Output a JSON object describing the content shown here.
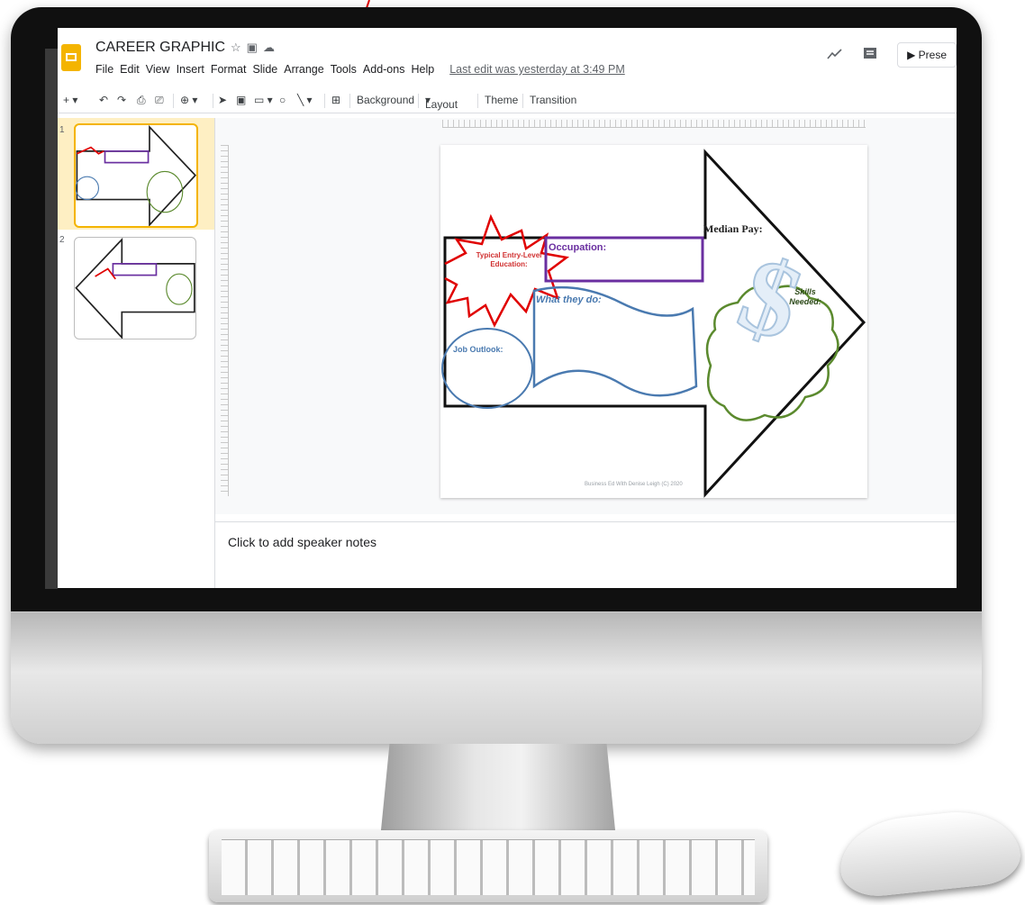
{
  "app": {
    "document_title": "CAREER GRAPHIC",
    "menu_items": [
      "File",
      "Edit",
      "View",
      "Insert",
      "Format",
      "Slide",
      "Arrange",
      "Tools",
      "Add-ons",
      "Help"
    ],
    "last_edit": "Last edit was yesterday at 3:49 PM",
    "present_label": "Prese"
  },
  "toolbar": {
    "background_label": "Background",
    "layout_label": "Layout",
    "theme_label": "Theme",
    "transition_label": "Transition"
  },
  "filmstrip": {
    "slides": [
      {
        "number": "1"
      },
      {
        "number": "2"
      }
    ]
  },
  "slide": {
    "occupation_label": "Occupation:",
    "entry_level_label": "Typical Entry-Level Education:",
    "what_they_do_label": "What they do:",
    "job_outlook_label": "Job Outlook:",
    "median_pay_label": "Median Pay:",
    "skills_needed_label": "Skills Needed:",
    "footer": "Business Ed With Denise Leigh (C) 2020"
  },
  "notes": {
    "placeholder": "Click to add speaker notes"
  },
  "colors": {
    "accent_yellow": "#f4b400",
    "occupation_purple": "#6a2fa0",
    "burst_red": "#e00000",
    "blue_outline": "#4a7ab0",
    "cloud_green": "#5b8a2e"
  }
}
